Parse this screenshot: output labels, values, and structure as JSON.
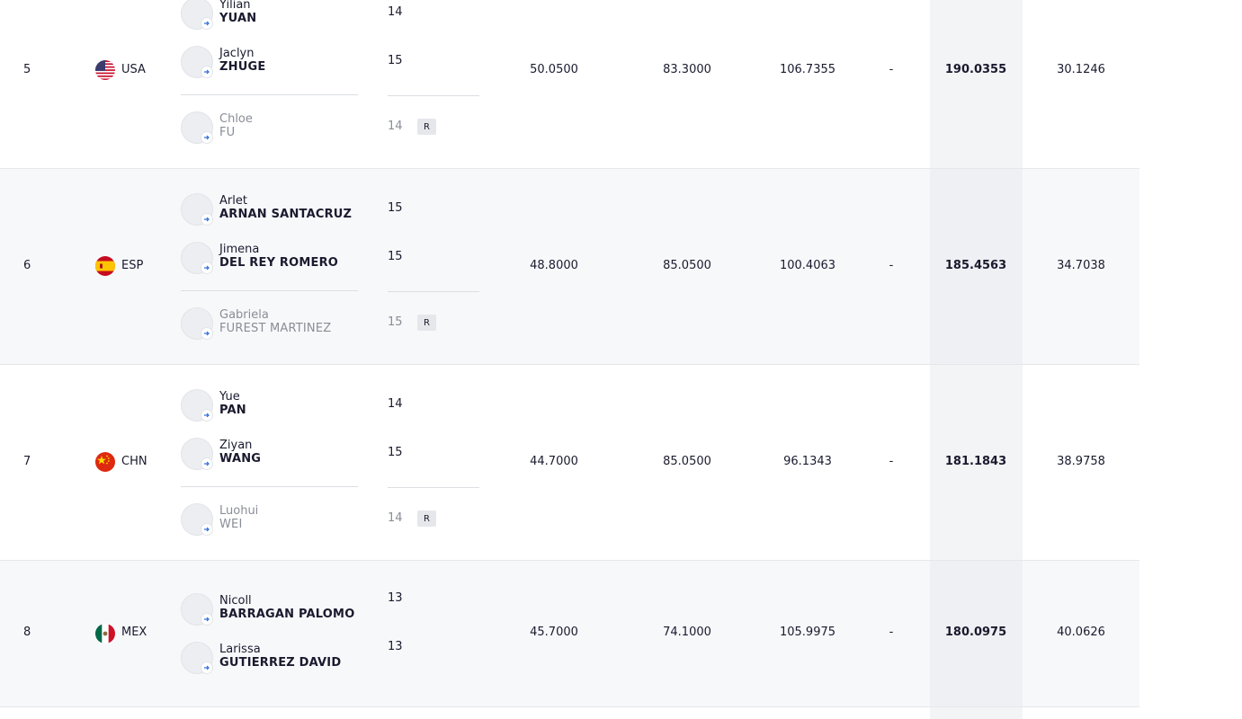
{
  "reserve_badge": "R",
  "rows": [
    {
      "rank": "5",
      "country": "USA",
      "athletes": [
        {
          "first": "Yilian",
          "last": "YUAN",
          "age": "14"
        },
        {
          "first": "Jaclyn",
          "last": "ZHUGE",
          "age": "15"
        },
        {
          "first": "Chloe",
          "last": "FU",
          "age": "14"
        }
      ],
      "score1": "50.0500",
      "score2": "83.3000",
      "score3": "106.7355",
      "penalty": "-",
      "total": "190.0355",
      "behind": "30.1246"
    },
    {
      "rank": "6",
      "country": "ESP",
      "athletes": [
        {
          "first": "Arlet",
          "last": "ARNAN SANTACRUZ",
          "age": "15"
        },
        {
          "first": "Jimena",
          "last": "DEL REY ROMERO",
          "age": "15"
        },
        {
          "first": "Gabriela",
          "last": "FUREST MARTINEZ",
          "age": "15"
        }
      ],
      "score1": "48.8000",
      "score2": "85.0500",
      "score3": "100.4063",
      "penalty": "-",
      "total": "185.4563",
      "behind": "34.7038"
    },
    {
      "rank": "7",
      "country": "CHN",
      "athletes": [
        {
          "first": "Yue",
          "last": "PAN",
          "age": "14"
        },
        {
          "first": "Ziyan",
          "last": "WANG",
          "age": "15"
        },
        {
          "first": "Luohui",
          "last": "WEI",
          "age": "14"
        }
      ],
      "score1": "44.7000",
      "score2": "85.0500",
      "score3": "96.1343",
      "penalty": "-",
      "total": "181.1843",
      "behind": "38.9758"
    },
    {
      "rank": "8",
      "country": "MEX",
      "athletes": [
        {
          "first": "Nicoll",
          "last": "BARRAGAN PALOMO",
          "age": "13"
        },
        {
          "first": "Larissa",
          "last": "GUTIERREZ DAVID",
          "age": "13"
        }
      ],
      "score1": "45.7000",
      "score2": "74.1000",
      "score3": "105.9975",
      "penalty": "-",
      "total": "180.0975",
      "behind": "40.0626"
    }
  ]
}
